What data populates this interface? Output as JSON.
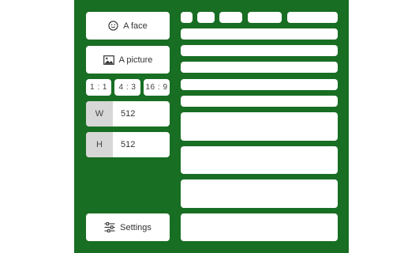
{
  "colors": {
    "panel_background": "#186e23",
    "card_background": "#ffffff",
    "label_background": "#d7d7d7"
  },
  "sidebar": {
    "face_button": {
      "label": "A face",
      "icon": "smiley-face-icon"
    },
    "picture_button": {
      "label": "A picture",
      "icon": "image-icon"
    },
    "aspect_ratios": [
      "1 : 1",
      "4 : 3",
      "16 : 9"
    ],
    "width": {
      "label": "W",
      "value": "512"
    },
    "height": {
      "label": "H",
      "value": "512"
    },
    "settings_button": {
      "label": "Settings",
      "icon": "sliders-icon"
    }
  }
}
